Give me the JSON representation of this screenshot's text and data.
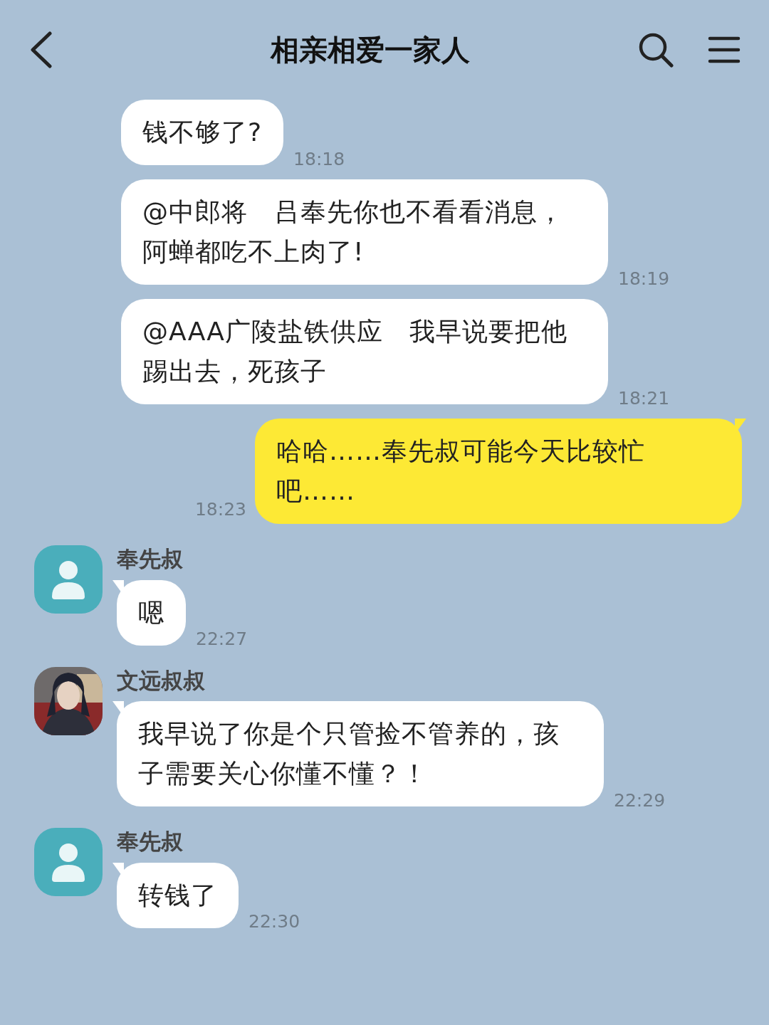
{
  "header": {
    "title": "相亲相爱一家人"
  },
  "messages": [
    {
      "kind": "incoming",
      "text": "钱不够了?",
      "time": "18:18",
      "tail": false
    },
    {
      "kind": "incoming",
      "text": "@中郎将　吕奉先你也不看看消息，阿蝉都吃不上肉了!",
      "time": "18:19",
      "tail": false
    },
    {
      "kind": "incoming",
      "text": "@AAA广陵盐铁供应　我早说要把他踢出去，死孩子",
      "time": "18:21",
      "tail": false
    },
    {
      "kind": "outgoing",
      "text": "哈哈……奉先叔可能今天比较忙吧……",
      "time": "18:23",
      "tail": true
    },
    {
      "kind": "incoming",
      "sender": "奉先叔",
      "avatar": {
        "kind": "default"
      },
      "text": "嗯",
      "time": "22:27",
      "tail": true
    },
    {
      "kind": "incoming",
      "sender": "文远叔叔",
      "text": "我早说了你是个只管捡不管养的，孩子需要关心你懂不懂？！",
      "time": "22:29",
      "tail": true
    },
    {
      "kind": "incoming",
      "sender": "奉先叔",
      "avatar": {
        "kind": "default"
      },
      "text": "转钱了",
      "time": "22:30",
      "tail": true
    }
  ]
}
